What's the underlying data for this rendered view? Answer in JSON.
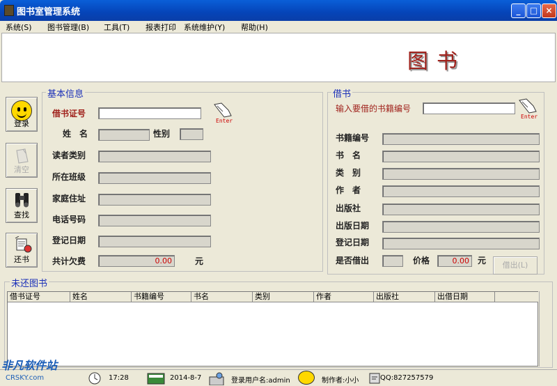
{
  "window": {
    "title": "图书室管理系统"
  },
  "menu": [
    "系统(S)",
    "图书管理(B)",
    "工具(T)",
    "报表打印",
    "系统维护(Y)",
    "帮助(H)"
  ],
  "banner": {
    "title": "图书"
  },
  "tools": [
    {
      "label": "登录",
      "enabled": true
    },
    {
      "label": "清空",
      "enabled": false
    },
    {
      "label": "查找",
      "enabled": true
    },
    {
      "label": "还书",
      "enabled": true
    }
  ],
  "basic": {
    "title": "基本信息",
    "card_label": "借书证号",
    "name_label": "姓　名",
    "gender_label": "性别",
    "reader_type_label": "读者类别",
    "class_label": "所在班级",
    "address_label": "家庭住址",
    "phone_label": "电话号码",
    "reg_date_label": "登记日期",
    "debt_label": "共计欠费",
    "debt_value": "0.00",
    "debt_unit": "元",
    "enter_text": "Enter"
  },
  "borrow": {
    "title": "借书",
    "input_label": "输入要借的书籍编号",
    "enter_text": "Enter",
    "book_no_label": "书籍编号",
    "book_name_label": "书　名",
    "category_label": "类　别",
    "author_label": "作　者",
    "publisher_label": "出版社",
    "pub_date_label": "出版日期",
    "reg_date_label": "登记日期",
    "lent_label": "是否借出",
    "price_label": "价格",
    "price_value": "0.00",
    "price_unit": "元",
    "borrow_button": "借出(L)"
  },
  "unreturned": {
    "title": "未还图书",
    "columns": [
      "借书证号",
      "姓名",
      "书籍编号",
      "书名",
      "类别",
      "作者",
      "出版社",
      "出借日期"
    ]
  },
  "status": {
    "time": "17:28",
    "date": "2014-8-7",
    "user": "登录用户名:admin",
    "author": "制作者:小小",
    "qq": "QQ:827257579",
    "watermark": "非凡软件站",
    "watermark_sub": "CRSKY.com"
  }
}
